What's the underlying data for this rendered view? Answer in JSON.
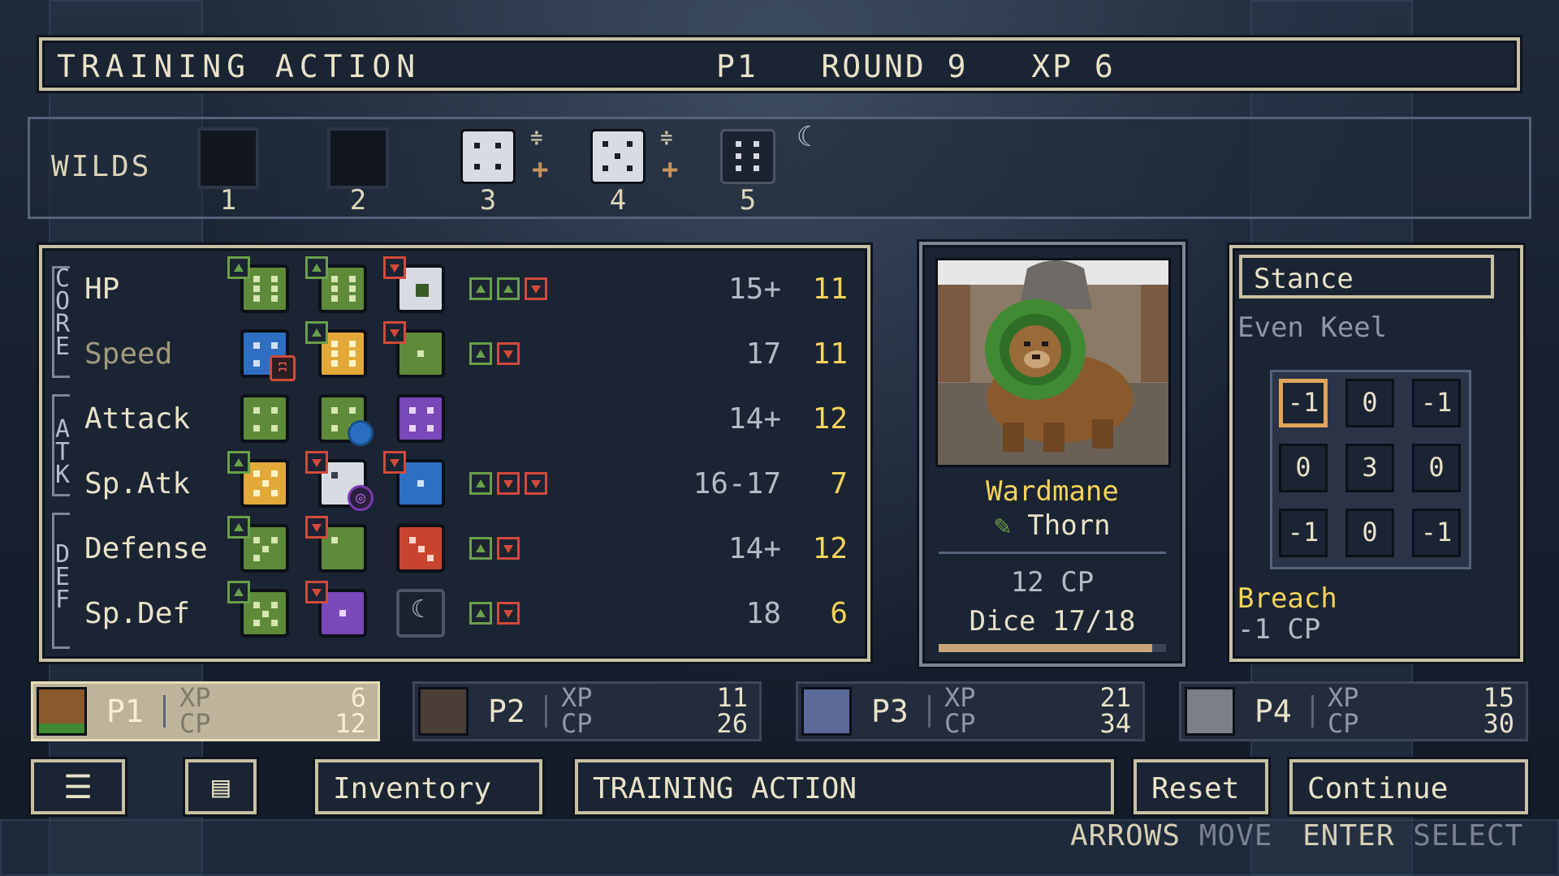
{
  "header": {
    "title": "TRAINING ACTION",
    "player": "P1",
    "round": "ROUND 9",
    "xp": "XP 6"
  },
  "wilds": {
    "label": "WILDS",
    "slots": [
      "1",
      "2",
      "3",
      "4",
      "5"
    ]
  },
  "stats": {
    "groups": [
      "CORE",
      "ATK",
      "DEF"
    ],
    "rows": [
      {
        "name": "HP",
        "range": "15+",
        "value": "11"
      },
      {
        "name": "Speed",
        "range": "17",
        "value": "11"
      },
      {
        "name": "Attack",
        "range": "14+",
        "value": "12"
      },
      {
        "name": "Sp.Atk",
        "range": "16-17",
        "value": "7"
      },
      {
        "name": "Defense",
        "range": "14+",
        "value": "12"
      },
      {
        "name": "Sp.Def",
        "range": "18",
        "value": "6"
      }
    ]
  },
  "character": {
    "name": "Wardmane",
    "type": "Thorn",
    "cp": "12 CP",
    "dice": "Dice 17/18",
    "dice_progress": 0.94
  },
  "stance": {
    "title": "Stance",
    "name": "Even Keel",
    "grid": [
      "-1",
      "0",
      "-1",
      "0",
      "3",
      "0",
      "-1",
      "0",
      "-1"
    ],
    "breach_name": "Breach",
    "breach_cost": "-1 CP"
  },
  "players": [
    {
      "id": "P1",
      "xp_label": "XP",
      "cp_label": "CP",
      "xp": "6",
      "cp": "12"
    },
    {
      "id": "P2",
      "xp_label": "XP",
      "cp_label": "CP",
      "xp": "11",
      "cp": "26"
    },
    {
      "id": "P3",
      "xp_label": "XP",
      "cp_label": "CP",
      "xp": "21",
      "cp": "34"
    },
    {
      "id": "P4",
      "xp_label": "XP",
      "cp_label": "CP",
      "xp": "15",
      "cp": "30"
    }
  ],
  "buttons": {
    "inventory": "Inventory",
    "action": "TRAINING ACTION",
    "reset": "Reset",
    "continue": "Continue"
  },
  "hints": {
    "arrows": "ARROWS",
    "move": "MOVE",
    "enter": "ENTER",
    "select": "SELECT"
  },
  "colors": {
    "accent": "#f3d35a",
    "up": "#6aa04a",
    "down": "#d24a3a"
  }
}
